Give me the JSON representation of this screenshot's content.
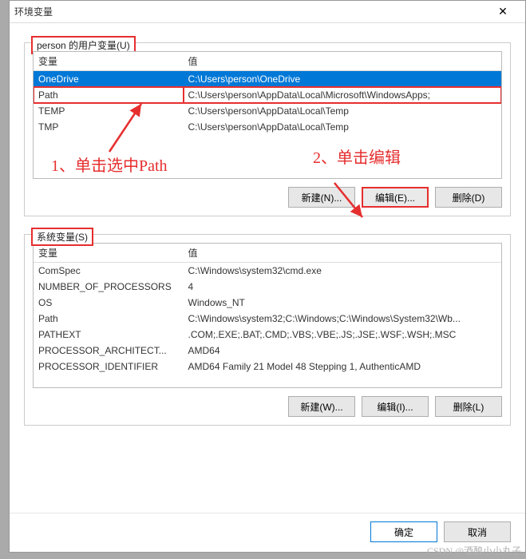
{
  "window": {
    "title": "环境变量",
    "close": "✕"
  },
  "userSection": {
    "label": "person 的用户变量(U)",
    "headers": {
      "name": "变量",
      "value": "值"
    },
    "rows": [
      {
        "name": "OneDrive",
        "value": "C:\\Users\\person\\OneDrive",
        "selected": true
      },
      {
        "name": "Path",
        "value": "C:\\Users\\person\\AppData\\Local\\Microsoft\\WindowsApps;",
        "redbox": true
      },
      {
        "name": "TEMP",
        "value": "C:\\Users\\person\\AppData\\Local\\Temp"
      },
      {
        "name": "TMP",
        "value": "C:\\Users\\person\\AppData\\Local\\Temp"
      }
    ],
    "buttons": {
      "new": "新建(N)...",
      "edit": "编辑(E)...",
      "del": "删除(D)"
    }
  },
  "systemSection": {
    "label": "系统变量(S)",
    "headers": {
      "name": "变量",
      "value": "值"
    },
    "rows": [
      {
        "name": "ComSpec",
        "value": "C:\\Windows\\system32\\cmd.exe"
      },
      {
        "name": "NUMBER_OF_PROCESSORS",
        "value": "4"
      },
      {
        "name": "OS",
        "value": "Windows_NT"
      },
      {
        "name": "Path",
        "value": "C:\\Windows\\system32;C:\\Windows;C:\\Windows\\System32\\Wb..."
      },
      {
        "name": "PATHEXT",
        "value": ".COM;.EXE;.BAT;.CMD;.VBS;.VBE;.JS;.JSE;.WSF;.WSH;.MSC"
      },
      {
        "name": "PROCESSOR_ARCHITECT...",
        "value": "AMD64"
      },
      {
        "name": "PROCESSOR_IDENTIFIER",
        "value": "AMD64 Family 21 Model 48 Stepping 1, AuthenticAMD"
      }
    ],
    "buttons": {
      "new": "新建(W)...",
      "edit": "编辑(I)...",
      "del": "删除(L)"
    }
  },
  "dialogButtons": {
    "ok": "确定",
    "cancel": "取消"
  },
  "annotations": {
    "step1": "1、单击选中Path",
    "step2": "2、单击编辑"
  },
  "watermark": "CSDN @酒酿小小丸子"
}
